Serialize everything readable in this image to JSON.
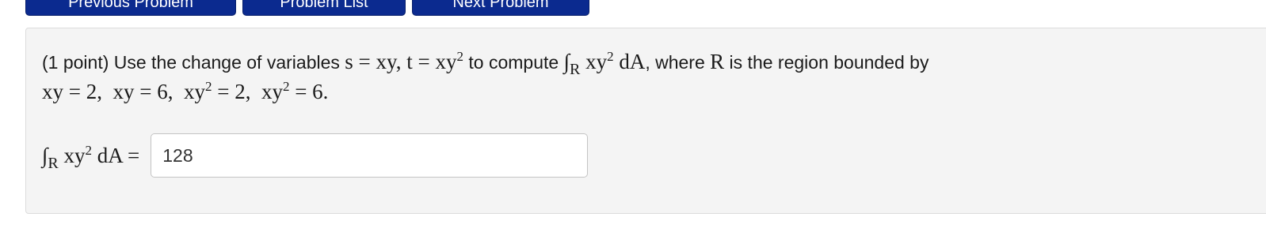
{
  "nav": {
    "previous_label": "Previous Problem",
    "list_label": "Problem List",
    "next_label": "Next Problem"
  },
  "problem": {
    "prefix": "(1 point) Use the change of variables ",
    "s_def": "s = xy",
    "comma": ", ",
    "t_def": "t = xy",
    "exp2": "2",
    "compute_text": " to compute ",
    "integral_sign": "∫",
    "region_symbol": "R",
    "integrand_base": " xy",
    "integrand_rest": " dA",
    "where_text": ", where ",
    "region_text": " is the region bounded by",
    "bound1": "xy = 2,",
    "bound2": "xy = 6,",
    "bound3_base": "xy",
    "bound3_rest": " = 2,",
    "bound4_base": "xy",
    "bound4_rest": " = 6."
  },
  "answer": {
    "equals": " =",
    "value": "128"
  }
}
